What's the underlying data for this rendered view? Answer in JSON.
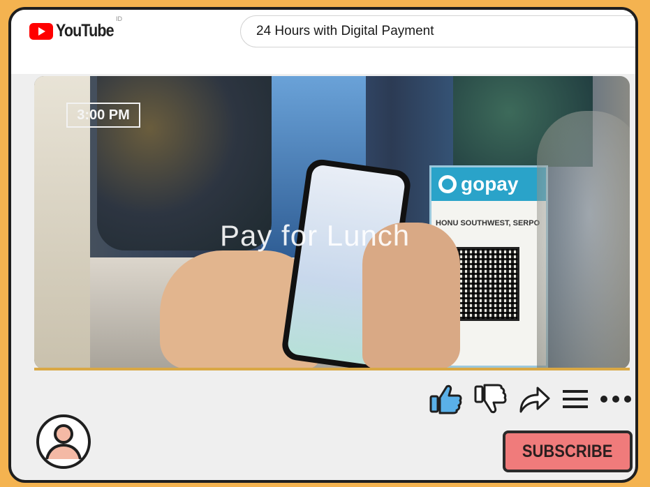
{
  "header": {
    "logo_text": "YouTube",
    "region_code": "ID",
    "search_value": "24 Hours with Digital Payment"
  },
  "video": {
    "timestamp_badge": "3:00 PM",
    "caption": "Pay for Lunch",
    "progress": 1.0,
    "merchant_brand": "gopay",
    "merchant_name": "HONU SOUTHWEST, SERPO"
  },
  "actions": [
    {
      "name": "like",
      "icon": "thumbs-up-icon"
    },
    {
      "name": "dislike",
      "icon": "thumbs-down-icon"
    },
    {
      "name": "share",
      "icon": "share-arrow-icon"
    },
    {
      "name": "save",
      "icon": "list-icon"
    },
    {
      "name": "more",
      "icon": "more-dots-icon"
    }
  ],
  "channel": {
    "avatar_icon": "user-avatar-icon",
    "subscribe_label": "SUBSCRIBE"
  },
  "colors": {
    "background": "#f4b350",
    "subscribe": "#f07b7b",
    "progress": "#d9a845",
    "gopay": "#2aa3c9",
    "youtube_red": "#ff0000"
  }
}
